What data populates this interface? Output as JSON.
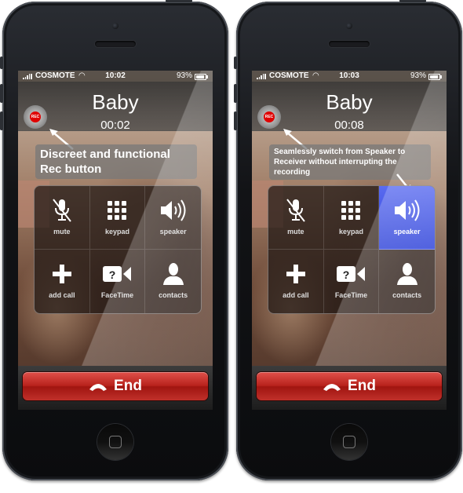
{
  "phones": [
    {
      "status": {
        "carrier": "COSMOTE",
        "time": "10:02",
        "battery": "93%"
      },
      "call": {
        "caller": "Baby",
        "duration": "00:02",
        "rec_label": "REC"
      },
      "annotation": "Discreet and functional Rec button",
      "buttons": [
        {
          "label": "mute",
          "icon": "mic-off-icon",
          "active": false
        },
        {
          "label": "keypad",
          "icon": "keypad-icon",
          "active": false
        },
        {
          "label": "speaker",
          "icon": "speaker-icon",
          "active": false
        },
        {
          "label": "add call",
          "icon": "plus-icon",
          "active": false
        },
        {
          "label": "FaceTime",
          "icon": "facetime-icon",
          "active": false
        },
        {
          "label": "contacts",
          "icon": "contact-icon",
          "active": false
        }
      ],
      "end_label": "End"
    },
    {
      "status": {
        "carrier": "COSMOTE",
        "time": "10:03",
        "battery": "93%"
      },
      "call": {
        "caller": "Baby",
        "duration": "00:08",
        "rec_label": "REC"
      },
      "annotation": "Seamlessly switch from Speaker to Receiver without interrupting the recording",
      "buttons": [
        {
          "label": "mute",
          "icon": "mic-off-icon",
          "active": false
        },
        {
          "label": "keypad",
          "icon": "keypad-icon",
          "active": false
        },
        {
          "label": "speaker",
          "icon": "speaker-icon",
          "active": true
        },
        {
          "label": "add call",
          "icon": "plus-icon",
          "active": false
        },
        {
          "label": "FaceTime",
          "icon": "facetime-icon",
          "active": false
        },
        {
          "label": "contacts",
          "icon": "contact-icon",
          "active": false
        }
      ],
      "end_label": "End"
    }
  ],
  "colors": {
    "rec": "#e00000",
    "end_button": "#b8221c",
    "speaker_active": "#3a4de0"
  }
}
